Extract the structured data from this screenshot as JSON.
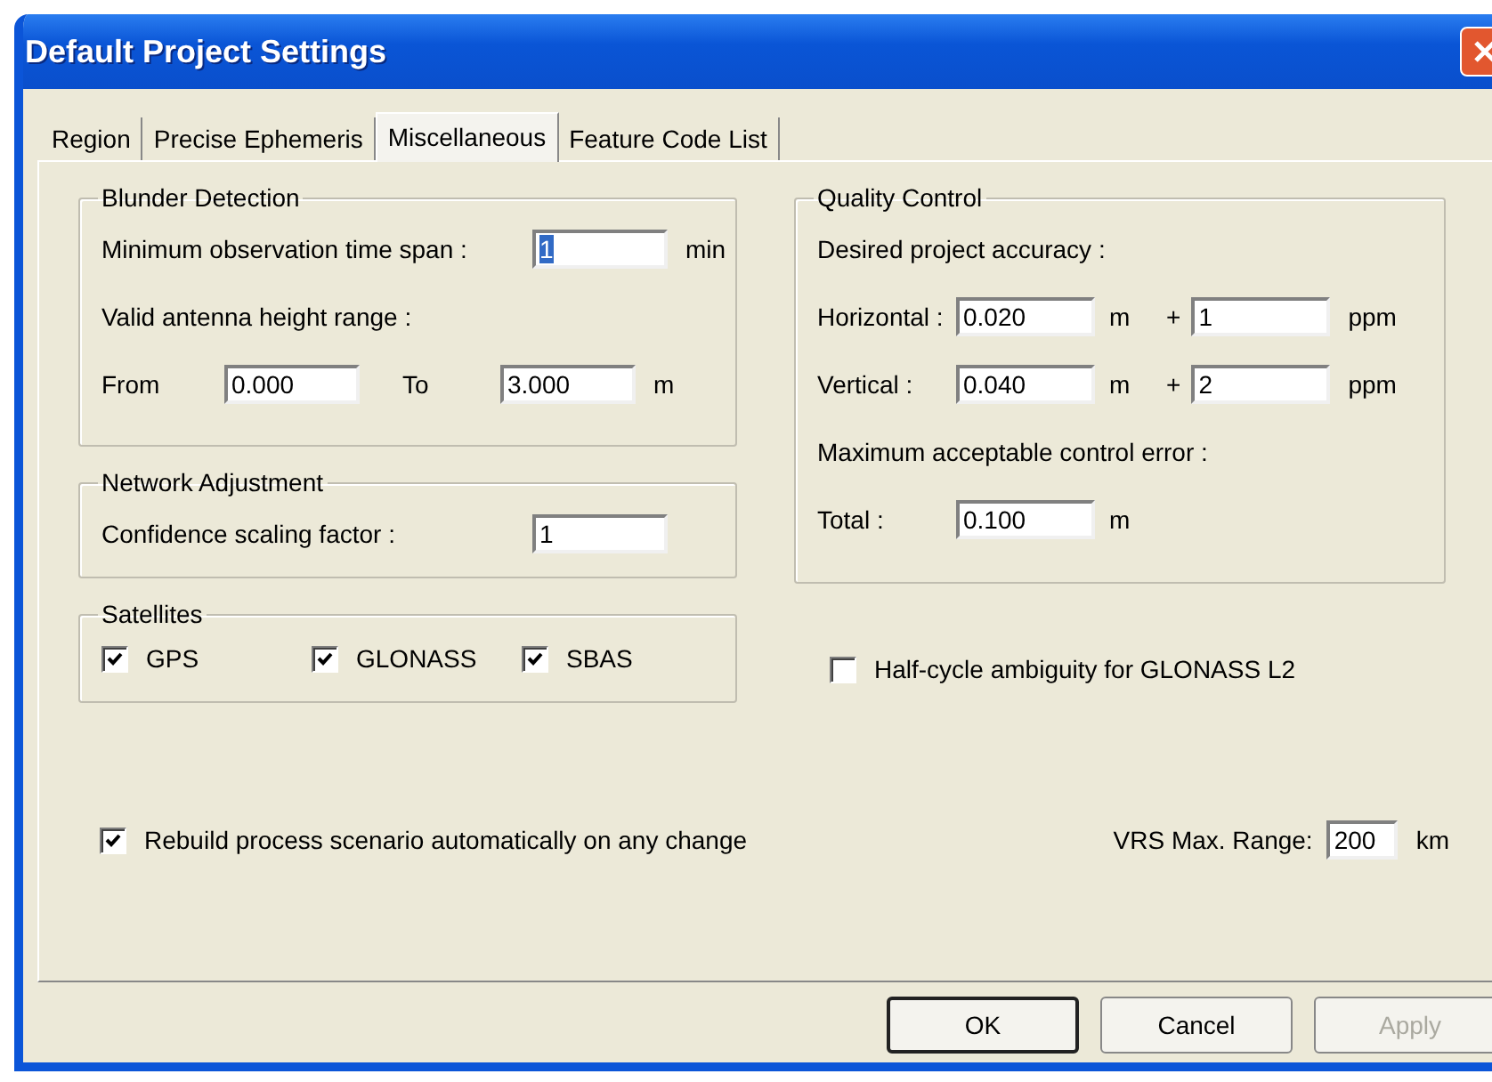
{
  "window": {
    "title": "Default Project Settings"
  },
  "tabs": [
    {
      "label": "Region",
      "selected": false
    },
    {
      "label": "Precise Ephemeris",
      "selected": false
    },
    {
      "label": "Miscellaneous",
      "selected": true
    },
    {
      "label": "Feature Code List",
      "selected": false
    }
  ],
  "blunder_detection": {
    "title": "Blunder Detection",
    "min_obs_label": "Minimum observation time span :",
    "min_obs_value": "1",
    "min_obs_value_selected": true,
    "min_obs_unit": "min",
    "antenna_label": "Valid antenna height range :",
    "from_label": "From",
    "from_value": "0.000",
    "to_label": "To",
    "to_value": "3.000",
    "range_unit": "m"
  },
  "network_adjustment": {
    "title": "Network Adjustment",
    "label": "Confidence scaling factor :",
    "value": "1"
  },
  "satellites": {
    "title": "Satellites",
    "items": [
      {
        "label": "GPS",
        "checked": true
      },
      {
        "label": "GLONASS",
        "checked": true
      },
      {
        "label": "SBAS",
        "checked": true
      }
    ]
  },
  "quality_control": {
    "title": "Quality Control",
    "accuracy_label": "Desired project accuracy :",
    "rows": [
      {
        "label": "Horizontal :",
        "value": "0.020",
        "unit": "m",
        "plus": "+",
        "ppm_value": "1",
        "ppm_unit": "ppm"
      },
      {
        "label": "Vertical :",
        "value": "0.040",
        "unit": "m",
        "plus": "+",
        "ppm_value": "2",
        "ppm_unit": "ppm"
      }
    ],
    "max_error_label": "Maximum acceptable control error :",
    "total_label": "Total :",
    "total_value": "0.100",
    "total_unit": "m"
  },
  "half_cycle": {
    "label": "Half-cycle ambiguity for GLONASS L2",
    "checked": false
  },
  "rebuild": {
    "label": "Rebuild process scenario automatically on any change",
    "checked": true
  },
  "vrs": {
    "label": "VRS Max. Range:",
    "value": "200",
    "unit": "km"
  },
  "buttons": [
    {
      "label": "OK",
      "default": true,
      "disabled": false
    },
    {
      "label": "Cancel",
      "default": false,
      "disabled": false
    },
    {
      "label": "Apply",
      "default": false,
      "disabled": true
    }
  ]
}
